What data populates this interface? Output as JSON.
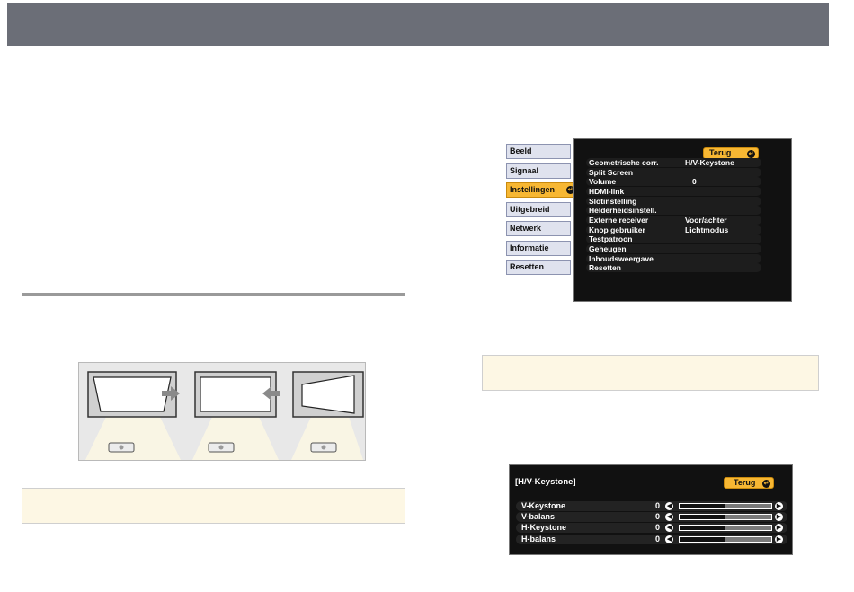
{
  "osd_menu": {
    "tabs": [
      {
        "label": "Beeld"
      },
      {
        "label": "Signaal"
      },
      {
        "label": "Instellingen"
      },
      {
        "label": "Uitgebreid"
      },
      {
        "label": "Netwerk"
      },
      {
        "label": "Informatie"
      },
      {
        "label": "Resetten"
      }
    ],
    "active_tab": "Instellingen",
    "return_label": "Terug",
    "items": [
      {
        "label": "Geometrische corr.",
        "value": "H/V-Keystone"
      },
      {
        "label": "Split Screen",
        "value": ""
      },
      {
        "label": "Volume",
        "value": "0"
      },
      {
        "label": "HDMI-link",
        "value": ""
      },
      {
        "label": "Slotinstelling",
        "value": ""
      },
      {
        "label": "Helderheidsinstell.",
        "value": ""
      },
      {
        "label": "Externe receiver",
        "value": "Voor/achter"
      },
      {
        "label": "Knop gebruiker",
        "value": "Lichtmodus"
      },
      {
        "label": "Testpatroon",
        "value": ""
      },
      {
        "label": "Geheugen",
        "value": ""
      },
      {
        "label": "Inhoudsweergave",
        "value": ""
      },
      {
        "label": "Resetten",
        "value": ""
      }
    ]
  },
  "keystone_panel": {
    "title": "[H/V-Keystone]",
    "return_label": "Terug",
    "rows": [
      {
        "label": "V-Keystone",
        "value": "0",
        "level": 0.5
      },
      {
        "label": "V-balans",
        "value": "0",
        "level": 0.5
      },
      {
        "label": "H-Keystone",
        "value": "0",
        "level": 0.5
      },
      {
        "label": "H-balans",
        "value": "0",
        "level": 0.5
      }
    ]
  },
  "icons": {
    "return": "return-icon",
    "left_arrow": "left-arrow-icon",
    "right_arrow": "right-arrow-icon",
    "projector": "projector-icon"
  },
  "colors": {
    "header_bar": "#6b6e77",
    "accent": "#f7b733",
    "note_background": "#fdf7e4"
  }
}
